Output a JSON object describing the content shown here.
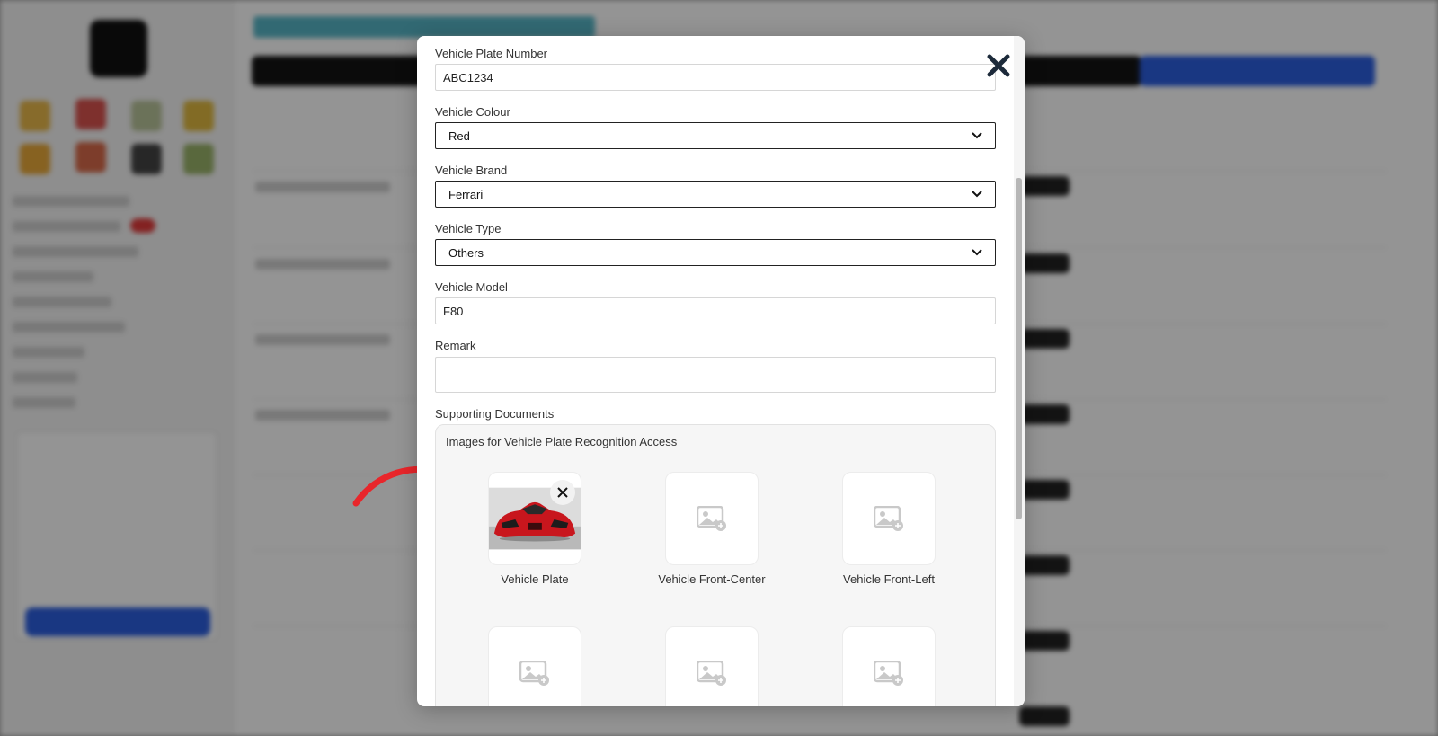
{
  "form": {
    "plate_number": {
      "label": "Vehicle Plate Number",
      "value": "ABC1234"
    },
    "colour": {
      "label": "Vehicle Colour",
      "value": "Red"
    },
    "brand": {
      "label": "Vehicle Brand",
      "value": "Ferrari"
    },
    "type": {
      "label": "Vehicle Type",
      "value": "Others"
    },
    "model": {
      "label": "Vehicle Model",
      "value": "F80"
    },
    "remark": {
      "label": "Remark",
      "value": ""
    }
  },
  "documents": {
    "label": "Supporting Documents",
    "panel_title": "Images for Vehicle Plate Recognition Access",
    "slots": [
      {
        "label": "Vehicle Plate",
        "has_image": true
      },
      {
        "label": "Vehicle Front-Center",
        "has_image": false
      },
      {
        "label": "Vehicle Front-Left",
        "has_image": false
      },
      {
        "label": "",
        "has_image": false
      },
      {
        "label": "",
        "has_image": false
      },
      {
        "label": "",
        "has_image": false
      }
    ]
  },
  "icons": {
    "close": "close-icon",
    "dropdown": "chevron-down-icon",
    "placeholder": "image-add-icon",
    "remove": "remove-image-icon",
    "annotation": "red-arrow-icon"
  },
  "colors": {
    "overlay": "#5c5c5c",
    "select_border": "#222222",
    "annotation_arrow": "#e8262b",
    "car": "#c8161d"
  }
}
